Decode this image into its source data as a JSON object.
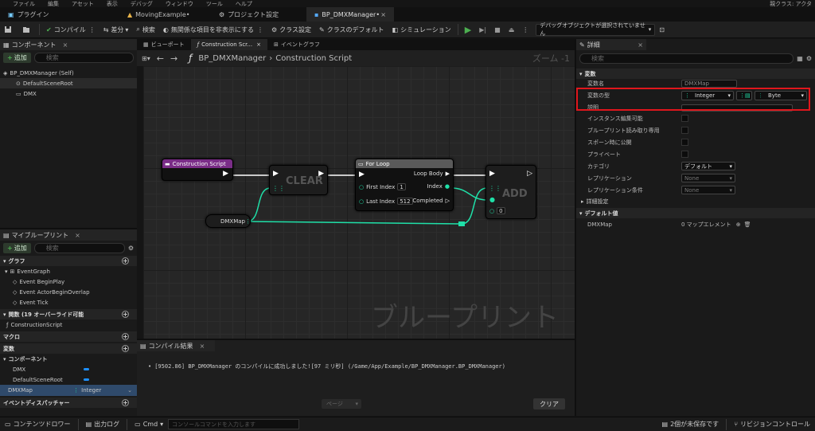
{
  "menu": [
    "ファイル",
    "編集",
    "アセット",
    "表示",
    "デバッグ",
    "ウィンドウ",
    "ツール",
    "ヘルプ"
  ],
  "menu_right": "親クラス: アクタ",
  "tabs": [
    "プラグイン",
    "MovingExample•",
    "プロジェクト設定",
    "BP_DMXManager•"
  ],
  "toolbar": {
    "compile": "コンパイル",
    "diff": "差分",
    "find": "検索",
    "hide": "無関係な項目を非表示にする",
    "class_settings": "クラス設定",
    "class_defaults": "クラスのデフォルト",
    "simulation": "シミュレーション",
    "debug_object": "デバッグオブジェクトが選択されていません"
  },
  "components": {
    "title": "コンポーネント",
    "add": "追加",
    "search_placeholder": "検索",
    "root": "BP_DMXManager (Self)",
    "items": [
      "DefaultSceneRoot",
      "DMX"
    ]
  },
  "viewport_tabs": [
    "ビューポート",
    "Construction Scr...",
    "イベントグラフ"
  ],
  "breadcrumb": {
    "path": "BP_DMXManager",
    "current": "Construction Script",
    "zoom": "ズーム -1"
  },
  "graph": {
    "watermark": "ブループリント",
    "nodes": {
      "construction": "Construction Script",
      "clear": "CLEAR",
      "dmxmap": "DMXMap",
      "forloop": {
        "title": "For Loop",
        "first": "First Index",
        "first_val": "1",
        "last": "Last Index",
        "last_val": "512",
        "loop_body": "Loop Body",
        "index": "Index",
        "completed": "Completed"
      },
      "add": "ADD",
      "add_val": "0"
    }
  },
  "myblueprint": {
    "title": "マイブループリント",
    "add": "追加",
    "search_placeholder": "検索",
    "graph": "グラフ",
    "event_graph": "EventGraph",
    "events": [
      "Event BeginPlay",
      "Event ActorBeginOverlap",
      "Event Tick"
    ],
    "functions": "関数 (19 オーバーライド可能",
    "construction": "ConstructionScript",
    "macros": "マクロ",
    "variables": "変数",
    "comp_label": "コンポーネント",
    "var_items": [
      "DMX",
      "DefaultSceneRoot"
    ],
    "selected_var": "DMXMap",
    "selected_type": "Integer",
    "dispatchers": "イベントディスパッチャー"
  },
  "compile_results": {
    "title": "コンパイル結果",
    "message": "[9502.86] BP_DMXManager のコンパイルに成功しました![97 ミリ秒] (/Game/App/Example/BP_DMXManager.BP_DMXManager)",
    "page": "ページ",
    "clear": "クリア"
  },
  "details": {
    "title": "詳細",
    "search_placeholder": "検索",
    "section_vars": "変数",
    "var_name_label": "変数名",
    "var_name": "DMXMap",
    "var_type_label": "変数の型",
    "key_type": "Integer",
    "value_type": "Byte",
    "description": "説明",
    "instance_editable": "インスタンス編集可能",
    "bp_readonly": "ブループリント読み取り専用",
    "expose_spawn": "スポーン時に公開",
    "private": "プライベート",
    "category": "カテゴリ",
    "category_val": "デフォルト",
    "replication": "レプリケーション",
    "replication_val": "None",
    "rep_condition": "レプリケーション条件",
    "rep_condition_val": "None",
    "advanced": "詳細設定",
    "section_default": "デフォルト値",
    "default_name": "DMXMap",
    "default_val": "0 マップエレメント"
  },
  "status": {
    "content_drawer": "コンテンツドロワー",
    "output_log": "出力ログ",
    "cmd": "Cmd",
    "console_placeholder": "コンソールコマンドを入力します",
    "unsaved": "2個が未保存です",
    "revision": "リビジョンコントロール"
  },
  "colors": {
    "highlight": "#e0161c",
    "int_pin": "#1fe0a8",
    "exec": "#ffffff",
    "construction_header": "#7a2d87",
    "green": "#4caf50"
  }
}
